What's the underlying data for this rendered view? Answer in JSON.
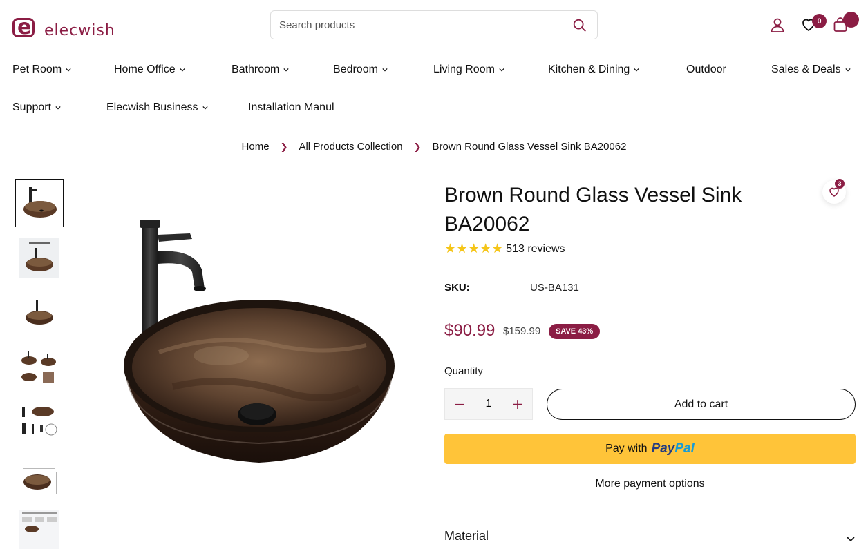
{
  "brand": {
    "name": "elecwish",
    "color": "#8b1d44"
  },
  "search": {
    "placeholder": "Search products"
  },
  "header": {
    "wishlist_count": "0",
    "account_icon": "user-icon",
    "wishlist_icon": "heart-icon",
    "cart_icon": "bag-icon"
  },
  "nav": {
    "items": [
      {
        "label": "Pet Room",
        "has_dropdown": true
      },
      {
        "label": "Home Office",
        "has_dropdown": true
      },
      {
        "label": "Bathroom",
        "has_dropdown": true
      },
      {
        "label": "Bedroom",
        "has_dropdown": true
      },
      {
        "label": "Living Room",
        "has_dropdown": true
      },
      {
        "label": "Kitchen & Dining",
        "has_dropdown": true
      },
      {
        "label": "Outdoor",
        "has_dropdown": false
      },
      {
        "label": "Sales & Deals",
        "has_dropdown": true
      },
      {
        "label": "Support",
        "has_dropdown": true
      },
      {
        "label": "Elecwish Business",
        "has_dropdown": true
      },
      {
        "label": "Installation Manul",
        "has_dropdown": false
      }
    ]
  },
  "breadcrumb": {
    "items": [
      "Home",
      "All Products Collection",
      "Brown Round Glass Vessel Sink BA20062"
    ]
  },
  "product": {
    "title": "Brown Round Glass Vessel Sink BA20062",
    "wishlist_count": "3",
    "rating_stars": "★★★★★",
    "reviews": "513 reviews",
    "sku_label": "SKU:",
    "sku_value": "US-BA131",
    "price": "$90.99",
    "compare_price": "$159.99",
    "save_badge": "SAVE 43%",
    "quantity_label": "Quantity",
    "quantity_value": "1",
    "add_to_cart": "Add to cart",
    "paypal_prefix": "Pay with",
    "paypal_brand_1": "Pay",
    "paypal_brand_2": "Pal",
    "more_payment": "More payment options",
    "material_label": "Material"
  },
  "colors": {
    "accent": "#8b1d44",
    "paypal": "#ffc439",
    "stars": "#f5c518"
  }
}
